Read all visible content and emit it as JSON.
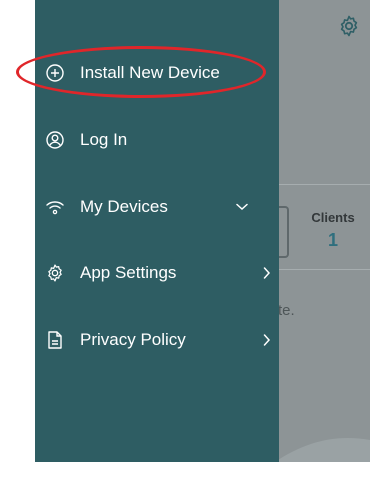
{
  "drawer": {
    "items": [
      {
        "label": "Install New Device",
        "icon": "plus-circle-icon"
      },
      {
        "label": "Log In",
        "icon": "user-circle-icon"
      },
      {
        "label": "My Devices",
        "icon": "wifi-icon",
        "indicator": "chevron-down-icon"
      },
      {
        "label": "App Settings",
        "icon": "gear-icon",
        "indicator": "chevron-right-icon"
      },
      {
        "label": "Privacy Policy",
        "icon": "document-icon",
        "indicator": "chevron-right-icon"
      }
    ]
  },
  "background": {
    "clients_label": "Clients",
    "clients_value": "1",
    "partial_text": "te."
  },
  "colors": {
    "drawer": "#2e5d63",
    "highlight": "#e0262a",
    "accent": "#2f6f7e"
  }
}
